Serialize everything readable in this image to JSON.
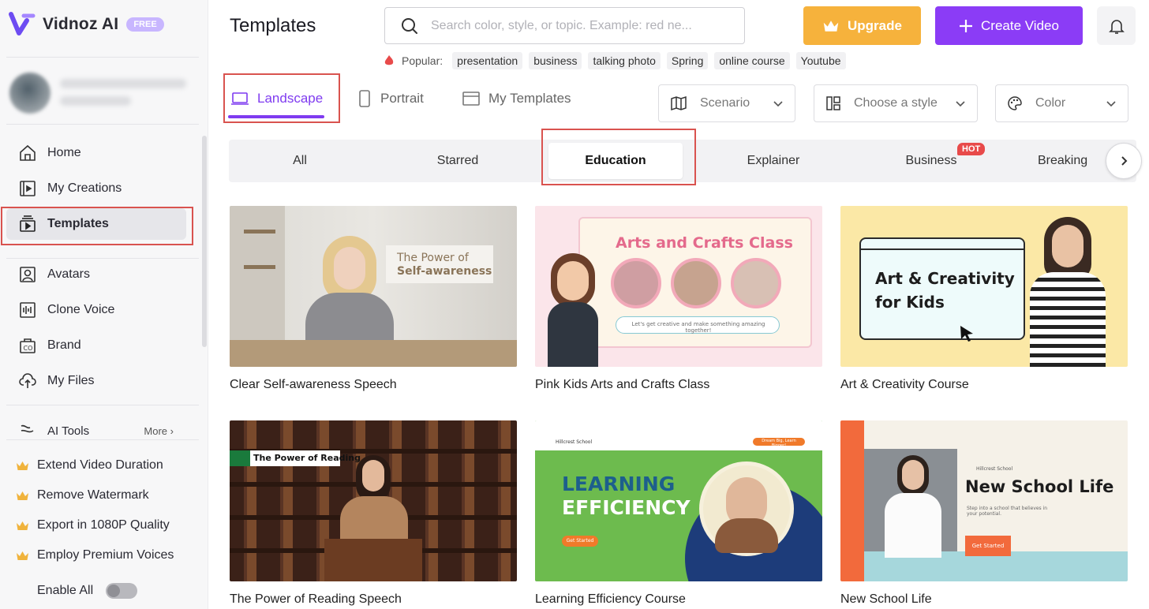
{
  "app": {
    "name": "Vidnoz AI",
    "plan_badge": "FREE"
  },
  "sidebar": {
    "nav": [
      {
        "label": "Home",
        "icon": "home-icon"
      },
      {
        "label": "My Creations",
        "icon": "play-square-icon"
      },
      {
        "label": "Templates",
        "icon": "templates-icon",
        "active": true
      },
      {
        "label": "Avatars",
        "icon": "avatar-icon"
      },
      {
        "label": "Clone Voice",
        "icon": "waveform-icon"
      },
      {
        "label": "Brand",
        "icon": "brand-icon"
      },
      {
        "label": "My Files",
        "icon": "cloud-upload-icon"
      }
    ],
    "ai_tools": {
      "label": "AI Tools",
      "more": "More"
    },
    "perks": [
      "Extend Video Duration",
      "Remove Watermark",
      "Export in 1080P Quality",
      "Employ Premium Voices"
    ],
    "enable_all": "Enable All"
  },
  "header": {
    "title": "Templates",
    "search_placeholder": "Search color, style, or topic. Example: red ne...",
    "upgrade": "Upgrade",
    "create": "Create Video",
    "popular_label": "Popular:",
    "popular_tags": [
      "presentation",
      "business",
      "talking photo",
      "Spring",
      "online course",
      "Youtube"
    ]
  },
  "orientation_tabs": [
    {
      "label": "Landscape",
      "active": true
    },
    {
      "label": "Portrait"
    },
    {
      "label": "My Templates"
    }
  ],
  "filters": {
    "scenario": "Scenario",
    "style": "Choose a style",
    "color": "Color"
  },
  "categories": {
    "items": [
      "All",
      "Starred",
      "Education",
      "Explainer",
      "Business",
      "Breaking"
    ],
    "active": "Education",
    "hot_badge": "HOT"
  },
  "templates": [
    {
      "title": "Clear Self-awareness Speech",
      "thumb_line1": "The Power of",
      "thumb_line2": "Self-awareness"
    },
    {
      "title": "Pink Kids Arts and Crafts Class",
      "thumb_heading": "Arts and Crafts Class",
      "thumb_caption": "Let's get creative and make something amazing together!"
    },
    {
      "title": "Art & Creativity Course",
      "thumb_line1": "Art & Creativity",
      "thumb_line2": "for Kids"
    },
    {
      "title": "The Power of Reading Speech",
      "thumb_banner": "The Power of Reading"
    },
    {
      "title": "Learning Efficiency Course",
      "thumb_school": "Hillcrest School",
      "thumb_pill": "Dream Big, Learn Bigger!",
      "thumb_line1": "LEARNING",
      "thumb_line2": "EFFICIENCY",
      "thumb_button": "Get Started"
    },
    {
      "title": "New School Life",
      "thumb_school": "Hillcrest School",
      "thumb_heading": "New School Life",
      "thumb_sub": "Step into a school that believes in your potential.",
      "thumb_button": "Get Started"
    }
  ],
  "colors": {
    "accent": "#8b3cf6",
    "upgrade": "#f6b23c",
    "hot": "#e84a4a",
    "highlight": "#d9534f"
  }
}
